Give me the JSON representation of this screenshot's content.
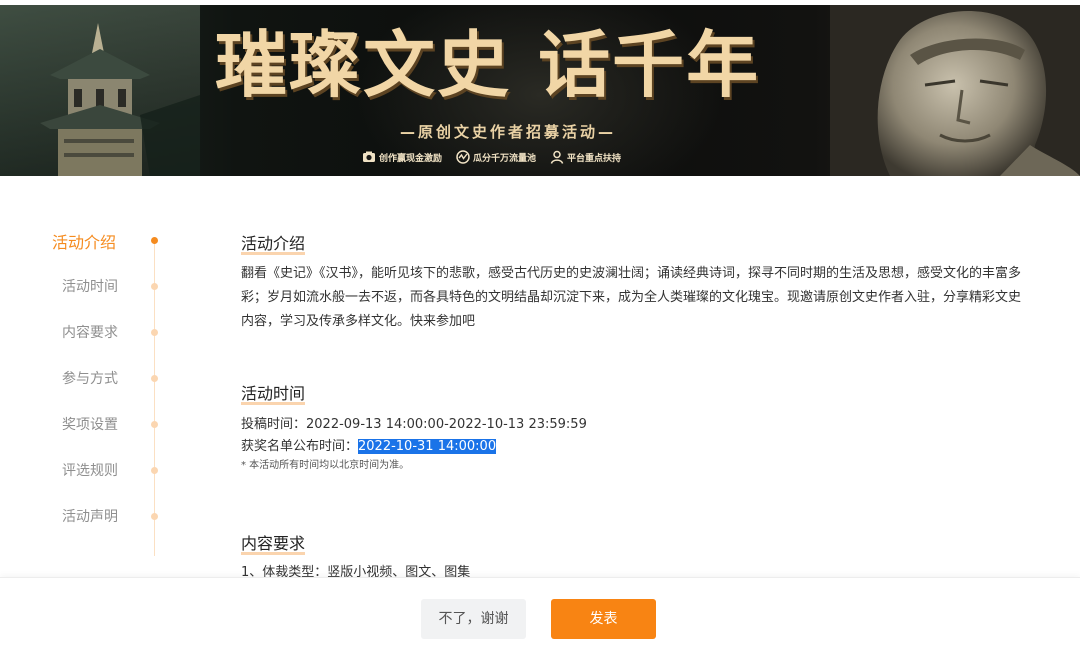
{
  "banner": {
    "title": "璀璨文史 话千年",
    "subtitle": "—原创文史作者招募活动—",
    "badges": [
      {
        "icon": "camera-icon",
        "label": "创作赢现金激励"
      },
      {
        "icon": "traffic-icon",
        "label": "瓜分千万流量池"
      },
      {
        "icon": "user-icon",
        "label": "平台重点扶持"
      }
    ]
  },
  "nav": {
    "items": [
      {
        "label": "活动介绍",
        "active": true
      },
      {
        "label": "活动时间"
      },
      {
        "label": "内容要求"
      },
      {
        "label": "参与方式"
      },
      {
        "label": "奖项设置"
      },
      {
        "label": "评选规则"
      },
      {
        "label": "活动声明"
      }
    ]
  },
  "intro": {
    "title": "活动介绍",
    "text": "翻看《史记》《汉书》，能听见垓下的悲歌，感受古代历史的史波澜壮阔；诵读经典诗词，探寻不同时期的生活及思想，感受文化的丰富多彩；岁月如流水般一去不返，而各具特色的文明结晶却沉淀下来，成为全人类璀璨的文化瑰宝。现邀请原创文史作者入驻，分享精彩文史内容，学习及传承多样文化。快来参加吧"
  },
  "time": {
    "title": "活动时间",
    "submit_label": "投稿时间：",
    "submit_value": "2022-09-13 14:00:00-2022-10-13 23:59:59",
    "announce_label": "获奖名单公布时间：",
    "announce_value": "2022-10-31 14:00:00",
    "note": "* 本活动所有时间均以北京时间为准。"
  },
  "requirements": {
    "title": "内容要求",
    "first_item": "1、体裁类型：竖版小视频、图文、图集"
  },
  "footer": {
    "cancel_label": "不了，谢谢",
    "publish_label": "发表"
  },
  "colors": {
    "accent": "#f88413",
    "nav_active": "#f58b1f",
    "highlight": "#1a73e8"
  }
}
